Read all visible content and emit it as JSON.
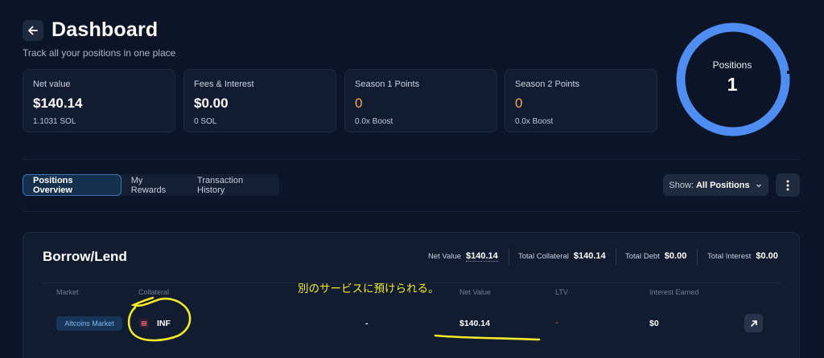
{
  "header": {
    "title": "Dashboard",
    "subtitle": "Track all your positions in one place"
  },
  "stats": [
    {
      "label": "Net value",
      "value": "$140.14",
      "sub": "1.1031 SOL"
    },
    {
      "label": "Fees & Interest",
      "value": "$0.00",
      "sub": "0 SOL"
    },
    {
      "label": "Season 1 Points",
      "value": "0",
      "sub": "0.0x Boost"
    },
    {
      "label": "Season 2 Points",
      "value": "0",
      "sub": "0.0x Boost"
    }
  ],
  "positions_ring": {
    "label": "Positions",
    "value": "1",
    "accent": "#4f8df3"
  },
  "tabs": [
    {
      "label": "Positions Overview",
      "active": true
    },
    {
      "label": "My Rewards",
      "active": false
    },
    {
      "label": "Transaction History",
      "active": false
    }
  ],
  "filter": {
    "prefix": "Show:",
    "value": "All Positions"
  },
  "panel": {
    "title": "Borrow/Lend",
    "summary": [
      {
        "label": "Net Value",
        "value": "$140.14"
      },
      {
        "label": "Total Collateral",
        "value": "$140.14"
      },
      {
        "label": "Total Debt",
        "value": "$0.00"
      },
      {
        "label": "Total Interest",
        "value": "$0.00"
      }
    ],
    "columns": [
      "Market",
      "Collateral",
      "Net Value",
      "LTV",
      "Interest Earned"
    ],
    "rows": [
      {
        "market": "Altcoins Market",
        "collateral": "INF",
        "debt": "-",
        "net_value": "$140.14",
        "ltv": "-",
        "interest": "$0"
      }
    ]
  },
  "annotation": {
    "text": "別のサービスに預けられる。",
    "color": "#f4ea2a"
  },
  "colors": {
    "background": "#0c1527",
    "card": "#111c30",
    "accent": "#4f8df3",
    "points": "#f3a94b"
  }
}
